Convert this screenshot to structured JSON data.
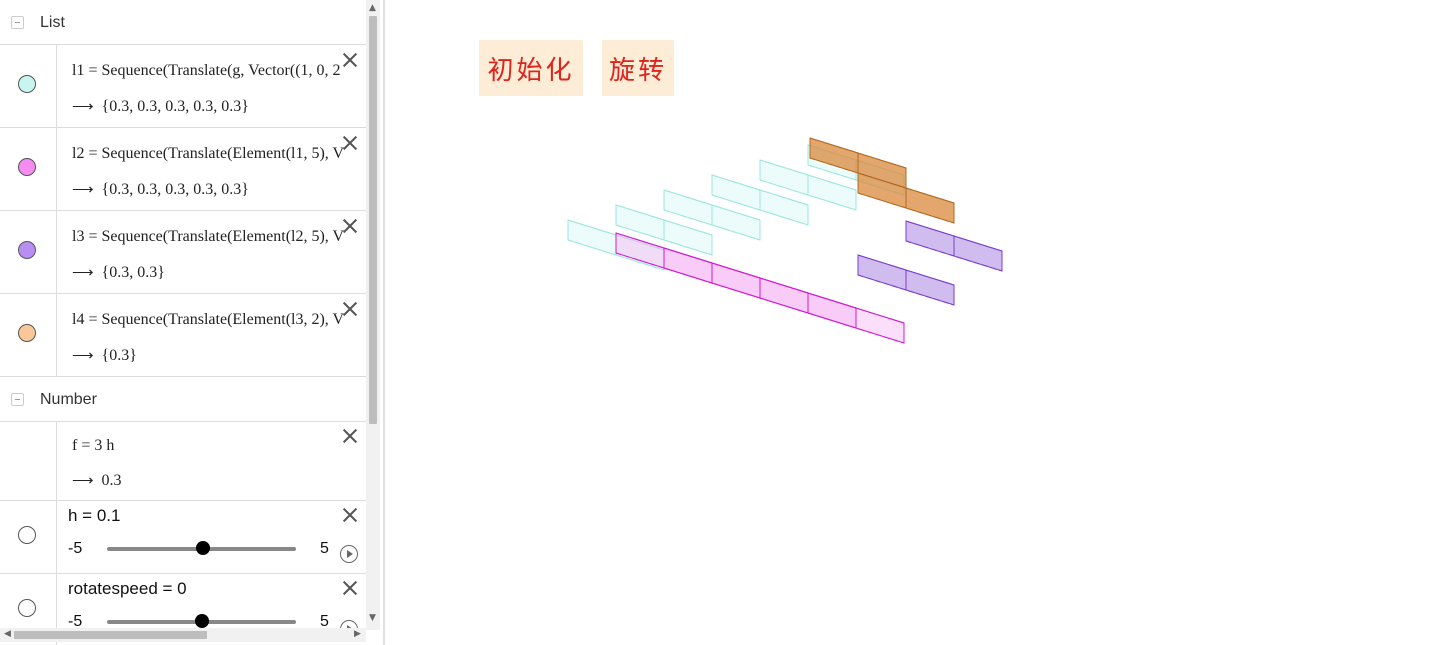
{
  "algebra": {
    "groups": {
      "list_title": "List",
      "number_title": "Number"
    },
    "items": [
      {
        "def": "l1 = Sequence(Translate(g, Vector((1, 0, 2",
        "out": "{0.3, 0.3, 0.3, 0.3, 0.3}",
        "color": "#c8f5f0"
      },
      {
        "def": "l2 = Sequence(Translate(Element(l1, 5), V",
        "out": "{0.3, 0.3, 0.3, 0.3, 0.3}",
        "color": "#f58cf2"
      },
      {
        "def": "l3 = Sequence(Translate(Element(l2, 5), V",
        "out": "{0.3, 0.3}",
        "color": "#b98ef2"
      },
      {
        "def": "l4 = Sequence(Translate(Element(l3, 2), V",
        "out": "{0.3}",
        "color": "#f8c898"
      }
    ],
    "number_item": {
      "def": "f = 3 h",
      "out": "0.3"
    },
    "sliders": [
      {
        "label": "h = 0.1",
        "min": "-5",
        "max": "5",
        "value": 0.1
      },
      {
        "label": "rotatespeed = 0",
        "min": "-5",
        "max": "5",
        "value": 0
      }
    ]
  },
  "graphics": {
    "buttons": {
      "init_label": "初始化",
      "rotate_label": "旋转"
    }
  },
  "icons": {
    "close": "close-icon",
    "play": "play-icon",
    "collapse": "collapse-icon",
    "arrow": "right-arrow-icon"
  },
  "colors": {
    "cyan": "#9ee6e0",
    "magenta": "#d21ad2",
    "purple": "#7a3fd0",
    "orange": "#d98a3c",
    "button_bg": "#fdecd6",
    "button_text": "#e0241c"
  }
}
